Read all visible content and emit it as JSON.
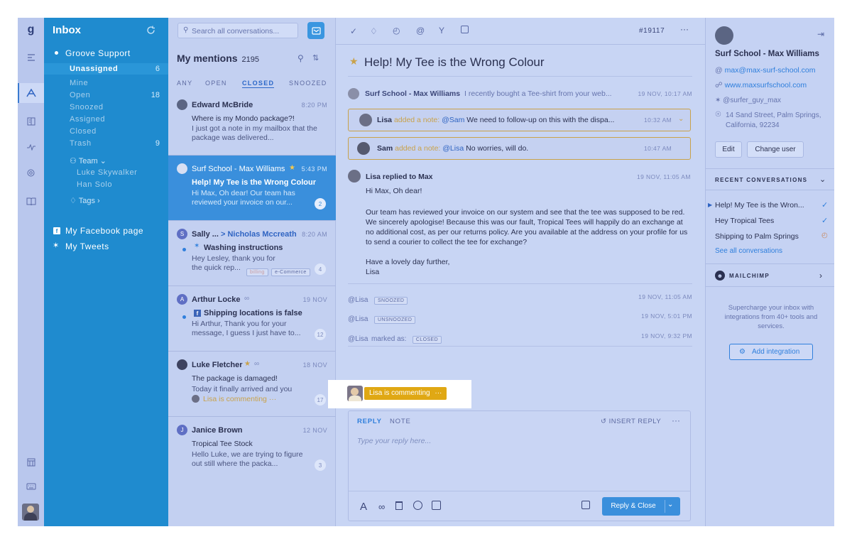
{
  "rail": {
    "logo": "g"
  },
  "folders": {
    "title": "Inbox",
    "mailbox": "Groove Support",
    "items": [
      {
        "label": "Unassigned",
        "count": "6"
      },
      {
        "label": "Mine",
        "count": ""
      },
      {
        "label": "Open",
        "count": "18"
      },
      {
        "label": "Snoozed",
        "count": ""
      },
      {
        "label": "Assigned",
        "count": ""
      },
      {
        "label": "Closed",
        "count": ""
      },
      {
        "label": "Trash",
        "count": "9"
      }
    ],
    "team": "Team",
    "members": [
      "Luke Skywalker",
      "Han Solo"
    ],
    "tags": "Tags",
    "facebook": "My Facebook page",
    "tweets": "My Tweets"
  },
  "list": {
    "search_placeholder": "Search all conversations...",
    "title": "My mentions",
    "count": "2195",
    "filters": [
      "ANY",
      "OPEN",
      "CLOSED",
      "SNOOZED"
    ],
    "conversations": [
      {
        "name": "Edward McBride",
        "time": "8:20 PM",
        "subject": "Where is my Mondo package?!",
        "preview": "I just got a note in my mailbox that the package was delivered...",
        "count": ""
      },
      {
        "name": "Surf School - Max Williams",
        "time": "5:43 PM",
        "subject": "Help! My Tee is the Wrong Colour",
        "preview": "Hi Max, Oh dear! Our team has reviewed your invoice on our...",
        "count": "2"
      },
      {
        "name": "Sally ...",
        "to": "> Nicholas Mccreath",
        "time": "8:20 AM",
        "subject": "Washing instructions",
        "preview": "Hey Lesley, thank you for the quick rep...",
        "tags": [
          "billing",
          "e-Commerce"
        ],
        "count": "4"
      },
      {
        "name": "Arthur Locke",
        "time": "19 NOV",
        "subject": "Shipping locations is false",
        "preview": "Hi Arthur, Thank you for your message, I guess I just have to...",
        "count": "12"
      },
      {
        "name": "Luke Fletcher",
        "time": "18 NOV",
        "subject": "The package is damaged!",
        "preview": "Today it finally arrived and you",
        "commenting": "Lisa is commenting ···",
        "count": "17"
      },
      {
        "name": "Janice Brown",
        "time": "12 NOV",
        "subject": "Tropical Tee Stock",
        "preview": "Hello Luke, we are trying to figure out still where the packa...",
        "count": "3"
      }
    ]
  },
  "ticket": {
    "number": "#19117",
    "title": "Help! My Tee is the Wrong Colour",
    "first_from": "Surf School - Max Williams",
    "first_preview": "I recently bought a Tee-shirt from your web...",
    "first_time": "19 NOV, 10:17 AM",
    "note1_who": "Lisa",
    "note1_action": "added a note:",
    "note1_mention": "@Sam",
    "note1_text": "We need to follow-up on this with the dispa...",
    "note1_time": "10:32 AM",
    "note2_who": "Sam",
    "note2_action": "added a note:",
    "note2_mention": "@Lisa",
    "note2_text": "No worries, will do.",
    "note2_time": "10:47 AM",
    "reply_header": "Lisa replied to Max",
    "reply_time": "19 NOV, 11:05 AM",
    "reply_greeting": "Hi Max, Oh dear!",
    "reply_body": "Our team has reviewed your invoice on our system and see that the tee was supposed to be red. We sincerely apologise! Because this was our fault, Tropical Tees will happily do an exchange at no additional cost, as per our returns policy. Are you available at the address on your profile for us to send a courier to collect the tee for exchange?",
    "reply_signoff": "Have a lovely day further,",
    "reply_sign": "Lisa",
    "events": [
      {
        "who": "@Lisa",
        "text": "",
        "tag": "SNOOZED",
        "time": "19 NOV, 11:05 AM"
      },
      {
        "who": "@Lisa",
        "text": "",
        "tag": "UNSNOOZED",
        "time": "19 NOV, 5:01 PM"
      },
      {
        "who": "@Lisa",
        "text": "marked as:",
        "tag": "CLOSED",
        "time": "19 NOV, 9:32 PM"
      }
    ],
    "commenting": "Lisa is commenting"
  },
  "composer": {
    "tab_reply": "REPLY",
    "tab_note": "NOTE",
    "insert": "INSERT REPLY",
    "placeholder": "Type your reply here...",
    "send": "Reply & Close"
  },
  "customer": {
    "name": "Surf School - Max Williams",
    "email": "max@max-surf-school.com",
    "website": "www.maxsurfschool.com",
    "twitter": "@surfer_guy_max",
    "address": "14 Sand Street, Palm Springs, California, 92234",
    "edit": "Edit",
    "change": "Change user",
    "recent_title": "RECENT CONVERSATIONS",
    "recent": [
      "Help! My Tee is the Wron...",
      "Hey Tropical Tees",
      "Shipping to Palm Springs"
    ],
    "see_all": "See all conversations",
    "mailchimp": "MAILCHIMP",
    "promo": "Supercharge your inbox with integrations from 40+ tools and services.",
    "add_integration": "Add integration"
  },
  "colors": {
    "accent": "#1f8bcf",
    "note": "#c9a24a",
    "comment": "#e0a814",
    "rail": "#b9c7ed"
  }
}
